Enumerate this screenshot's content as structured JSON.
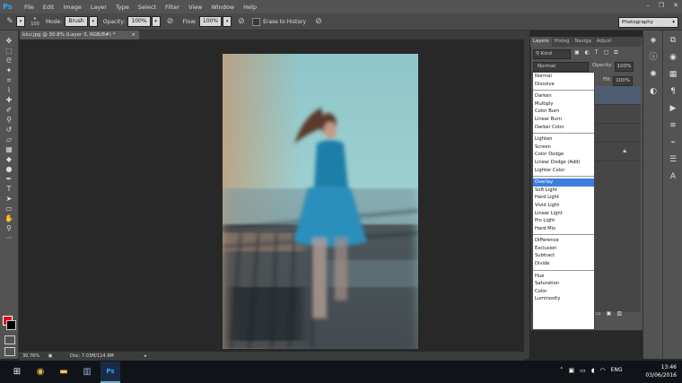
{
  "menubar": {
    "logo": "Ps",
    "items": [
      "File",
      "Edit",
      "Image",
      "Layer",
      "Type",
      "Select",
      "Filter",
      "View",
      "Window",
      "Help"
    ],
    "window_controls": [
      "–",
      "❐",
      "✕"
    ]
  },
  "options": {
    "size": "100",
    "mode_label": "Mode:",
    "mode_value": "Brush",
    "opacity_label": "Opacity:",
    "opacity_value": "100%",
    "flow_label": "Flow:",
    "flow_value": "100%",
    "erase_history_label": "Erase to History",
    "workspace": "Photography"
  },
  "document": {
    "tab_title": "blur.jpg @ 30.8% (Layer 3, RGB/8#) *",
    "tab_close": "×"
  },
  "status": {
    "zoom": "30.76%",
    "doc": "Doc: 7.03M/114.9M"
  },
  "panel": {
    "tabs": [
      "Layers",
      "Histog",
      "Naviga",
      "Adjust"
    ],
    "kind_label": "Kind",
    "blend_value": "Normal",
    "opacity_label": "Opacity:",
    "opacity_value": "100%",
    "fill_label": "Fill:",
    "fill_value": "100%"
  },
  "blend_modes": {
    "group1": [
      "Normal",
      "Dissolve"
    ],
    "group2": [
      "Darken",
      "Multiply",
      "Color Burn",
      "Linear Burn",
      "Darker Color"
    ],
    "group3": [
      "Lighten",
      "Screen",
      "Color Dodge",
      "Linear Dodge (Add)",
      "Lighter Color"
    ],
    "group4": [
      "Overlay",
      "Soft Light",
      "Hard Light",
      "Vivid Light",
      "Linear Light",
      "Pin Light",
      "Hard Mix"
    ],
    "group5": [
      "Difference",
      "Exclusion",
      "Subtract",
      "Divide"
    ],
    "group6": [
      "Hue",
      "Saturation",
      "Color",
      "Luminosity"
    ],
    "selected": "Overlay"
  },
  "taskbar": {
    "lang": "ENG",
    "time": "13:46",
    "date": "03/06/2016"
  },
  "colors": {
    "foreground": "#e30613",
    "background": "#000000",
    "accent": "#31a8ff"
  }
}
